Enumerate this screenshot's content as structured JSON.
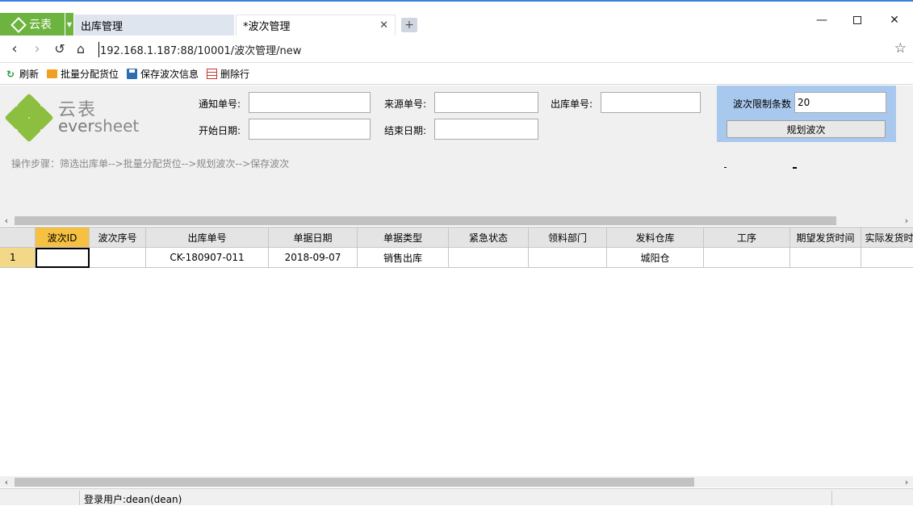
{
  "app": {
    "name": "云表"
  },
  "tabs": [
    {
      "label": "出库管理"
    },
    {
      "label": "*波次管理"
    }
  ],
  "address": {
    "url": "192.168.1.187:88/10001/波次管理/new"
  },
  "toolbar": {
    "refresh": "刷新",
    "batch_assign": "批量分配货位",
    "save_wave": "保存波次信息",
    "delete_row": "删除行"
  },
  "brand": {
    "cn": "云表",
    "en_a": "ever",
    "en_b": "sheet"
  },
  "form": {
    "notice_no_label": "通知单号:",
    "notice_no_value": "",
    "source_no_label": "来源单号:",
    "source_no_value": "",
    "outbound_no_label": "出库单号:",
    "outbound_no_value": "",
    "start_date_label": "开始日期:",
    "start_date_value": "",
    "end_date_label": "结束日期:",
    "end_date_value": "",
    "wave_limit_label": "波次限制条数",
    "wave_limit_value": "20",
    "plan_button": "规划波次",
    "steps_text": "操作步骤：筛选出库单-->批量分配货位-->规划波次-->保存波次"
  },
  "grid": {
    "columns": [
      "波次ID",
      "波次序号",
      "出库单号",
      "单据日期",
      "单据类型",
      "紧急状态",
      "领料部门",
      "发料仓库",
      "工序",
      "期望发货时间",
      "实际发货时"
    ],
    "rows": [
      {
        "num": "1",
        "cells": [
          "",
          "",
          "CK-180907-011",
          "2018-09-07",
          "销售出库",
          "",
          "",
          "城阳仓",
          "",
          "",
          ""
        ]
      }
    ]
  },
  "status": {
    "user": "登录用户:dean(dean)"
  },
  "colors": {
    "accent": "#6db33f",
    "selected_header": "#f6c142",
    "limit_panel": "#a8c8ee"
  }
}
